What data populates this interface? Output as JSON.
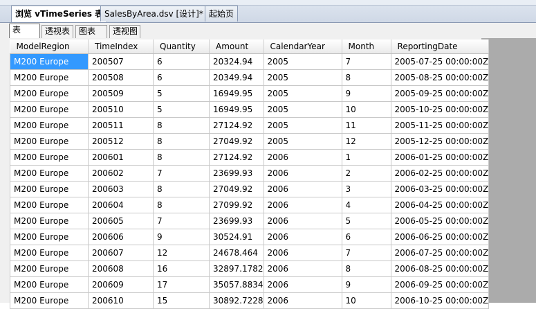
{
  "doc_tabs": [
    {
      "label": "浏览 vTimeSeries 表",
      "active": true
    },
    {
      "label": "SalesByArea.dsv [设计]*",
      "active": false
    },
    {
      "label": "起始页",
      "active": false
    }
  ],
  "view_tabs": [
    {
      "label": "表",
      "active": true
    },
    {
      "label": "透视表",
      "active": false
    },
    {
      "label": "图表",
      "active": false
    },
    {
      "label": "透视图",
      "active": false
    }
  ],
  "columns": [
    "ModelRegion",
    "TimeIndex",
    "Quantity",
    "Amount",
    "CalendarYear",
    "Month",
    "ReportingDate"
  ],
  "rows": [
    [
      "M200 Europe",
      "200507",
      "6",
      "20324.94",
      "2005",
      "7",
      "2005-07-25 00:00:00Z"
    ],
    [
      "M200 Europe",
      "200508",
      "6",
      "20349.94",
      "2005",
      "8",
      "2005-08-25 00:00:00Z"
    ],
    [
      "M200 Europe",
      "200509",
      "5",
      "16949.95",
      "2005",
      "9",
      "2005-09-25 00:00:00Z"
    ],
    [
      "M200 Europe",
      "200510",
      "5",
      "16949.95",
      "2005",
      "10",
      "2005-10-25 00:00:00Z"
    ],
    [
      "M200 Europe",
      "200511",
      "8",
      "27124.92",
      "2005",
      "11",
      "2005-11-25 00:00:00Z"
    ],
    [
      "M200 Europe",
      "200512",
      "8",
      "27049.92",
      "2005",
      "12",
      "2005-12-25 00:00:00Z"
    ],
    [
      "M200 Europe",
      "200601",
      "8",
      "27124.92",
      "2006",
      "1",
      "2006-01-25 00:00:00Z"
    ],
    [
      "M200 Europe",
      "200602",
      "7",
      "23699.93",
      "2006",
      "2",
      "2006-02-25 00:00:00Z"
    ],
    [
      "M200 Europe",
      "200603",
      "8",
      "27049.92",
      "2006",
      "3",
      "2006-03-25 00:00:00Z"
    ],
    [
      "M200 Europe",
      "200604",
      "8",
      "27099.92",
      "2006",
      "4",
      "2006-04-25 00:00:00Z"
    ],
    [
      "M200 Europe",
      "200605",
      "7",
      "23699.93",
      "2006",
      "5",
      "2006-05-25 00:00:00Z"
    ],
    [
      "M200 Europe",
      "200606",
      "9",
      "30524.91",
      "2006",
      "6",
      "2006-06-25 00:00:00Z"
    ],
    [
      "M200 Europe",
      "200607",
      "12",
      "24678.464",
      "2006",
      "7",
      "2006-07-25 00:00:00Z"
    ],
    [
      "M200 Europe",
      "200608",
      "16",
      "32897.1782",
      "2006",
      "8",
      "2006-08-25 00:00:00Z"
    ],
    [
      "M200 Europe",
      "200609",
      "17",
      "35057.8834",
      "2006",
      "9",
      "2006-09-25 00:00:00Z"
    ],
    [
      "M200 Europe",
      "200610",
      "15",
      "30892.7228",
      "2006",
      "10",
      "2006-10-25 00:00:00Z"
    ]
  ],
  "selected_cell": {
    "row": 0,
    "col": 0
  }
}
